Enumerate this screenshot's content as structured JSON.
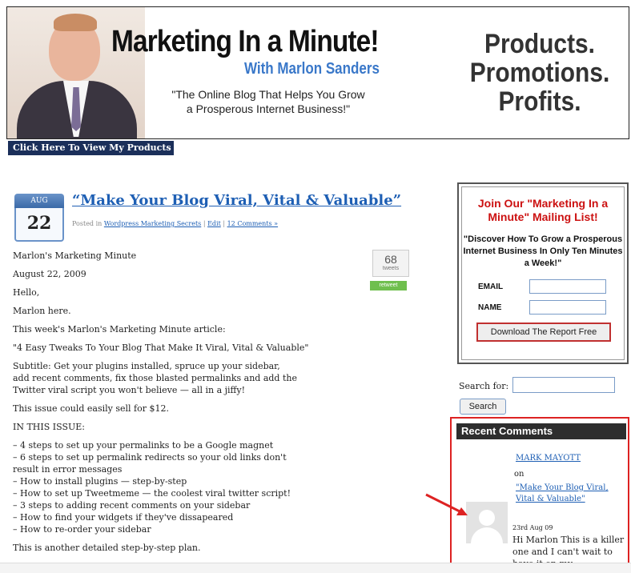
{
  "header": {
    "title": "Marketing In a Minute!",
    "subtitle": "With Marlon Sanders",
    "tagline_line1": "\"The Online Blog That Helps You Grow",
    "tagline_line2": "a Prosperous Internet Business!\"",
    "right_line1": "Products.",
    "right_line2": "Promotions.",
    "right_line3": "Profits.",
    "products_link": "Click Here To View My Products"
  },
  "post": {
    "date_month": "AUG",
    "date_day": "22",
    "title": "“Make Your Blog Viral, Vital & Valuable”",
    "meta_prefix": "Posted in",
    "meta_category": "Wordpress Marketing Secrets",
    "meta_sep1": "|",
    "meta_edit": "Edit",
    "meta_sep2": "|",
    "meta_comments": "12 Comments »",
    "tweet_count": "68",
    "tweet_label": "tweets",
    "retweet_label": "retweet",
    "paragraphs": [
      "Marlon's Marketing Minute",
      "August 22, 2009",
      "Hello,",
      "Marlon here.",
      "This week's Marlon's Marketing Minute article:",
      "\"4 Easy Tweaks To Your Blog That Make It Viral, Vital & Valuable\"",
      "Subtitle: Get your plugins installed, spruce up your sidebar,\nadd recent comments, fix those blasted permalinks and add the\nTwitter viral script you won't believe — all in a jiffy!",
      "This issue could easily sell for $12.",
      "IN THIS ISSUE:",
      "– 4 steps to set up your permalinks to be a Google magnet\n– 6 steps to set up permalink redirects so your old links don't\nresult in error messages\n– How to install plugins — step-by-step\n– How to set up Tweetmeme — the coolest viral twitter script!\n– 3 steps to adding recent comments on your sidebar\n– How to find your widgets if they've dissapeared\n– How to re-order your sidebar",
      "This is another detailed step-by-step plan."
    ]
  },
  "signup": {
    "title": "Join Our \"Marketing In a Minute\" Mailing List!",
    "pitch": "\"Discover How To Grow a Prosperous Internet Business In Only Ten Minutes a Week!\"",
    "email_label": "EMAIL",
    "name_label": "NAME",
    "email_value": "",
    "name_value": "",
    "button_label": "Download The Report Free"
  },
  "search": {
    "label": "Search for:",
    "value": "",
    "button_label": "Search"
  },
  "recent_comments": {
    "heading": "Recent Comments",
    "author": "MARK MAYOTT",
    "on": "on",
    "post_link": "\"Make Your Blog Viral, Vital & Valuable\"",
    "date": "23rd Aug 09",
    "text": "Hi Marlon This is a killer one and I can't wait to have it on my"
  },
  "colors": {
    "link": "#1e5fb4",
    "signup_red": "#cc1111",
    "highlight_red": "#dd2222",
    "nav_dark": "#1b2f5a"
  }
}
